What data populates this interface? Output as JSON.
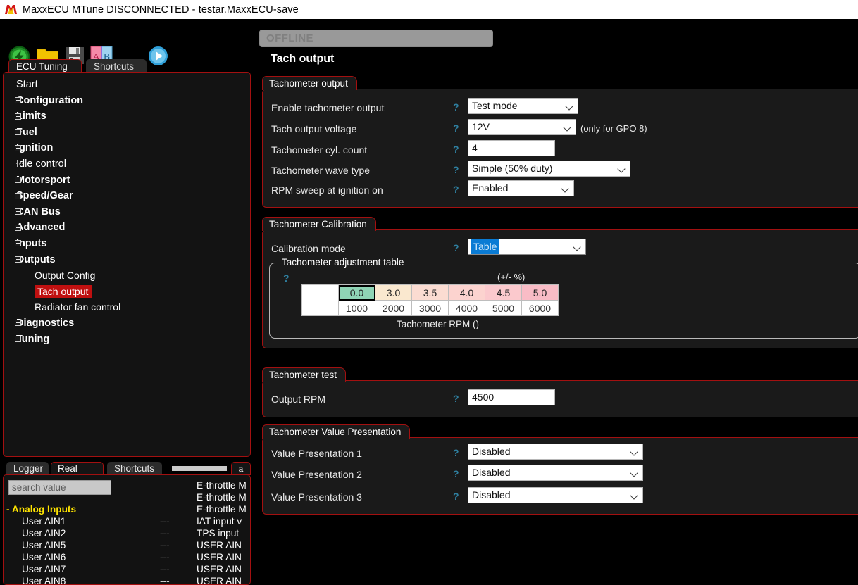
{
  "window": {
    "title": "MaxxECU MTune DISCONNECTED - testar.MaxxECU-save",
    "logo": "maxxecu-m-logo"
  },
  "toolbar": {
    "items": [
      {
        "name": "connect-icon",
        "label": "Connect"
      },
      {
        "name": "open-folder-icon",
        "label": "Open"
      },
      {
        "name": "save-icon",
        "label": "Save"
      },
      {
        "name": "compare-ab-icon",
        "label": "Compare A/B"
      },
      {
        "name": "play-icon",
        "label": "Start"
      }
    ]
  },
  "left_tabs": [
    {
      "label": "ECU Tuning",
      "active": true
    },
    {
      "label": "Shortcuts",
      "active": false
    }
  ],
  "tree": [
    {
      "label": "Start",
      "type": "leaf",
      "depth": 0
    },
    {
      "label": "Configuration",
      "type": "expandable",
      "depth": 0
    },
    {
      "label": "Limits",
      "type": "expandable",
      "depth": 0
    },
    {
      "label": "Fuel",
      "type": "expandable",
      "depth": 0
    },
    {
      "label": "Ignition",
      "type": "expandable",
      "depth": 0
    },
    {
      "label": "Idle control",
      "type": "leaf",
      "depth": 0
    },
    {
      "label": "Motorsport",
      "type": "expandable",
      "depth": 0
    },
    {
      "label": "Speed/Gear",
      "type": "expandable",
      "depth": 0
    },
    {
      "label": "CAN Bus",
      "type": "expandable",
      "depth": 0
    },
    {
      "label": "Advanced",
      "type": "expandable",
      "depth": 0
    },
    {
      "label": "Inputs",
      "type": "expandable",
      "depth": 0
    },
    {
      "label": "Outputs",
      "type": "expanded",
      "depth": 0
    },
    {
      "label": "Output Config",
      "type": "child",
      "depth": 1
    },
    {
      "label": "Tach output",
      "type": "child",
      "depth": 1,
      "selected": true
    },
    {
      "label": "Radiator fan control",
      "type": "child",
      "depth": 1
    },
    {
      "label": "Diagnostics",
      "type": "expandable",
      "depth": 0
    },
    {
      "label": "Tuning",
      "type": "expandable",
      "depth": 0
    }
  ],
  "status_banner": "OFFLINE",
  "page_title": "Tach output",
  "groups": {
    "tach_output": {
      "title": "Tachometer output",
      "rows": [
        {
          "label": "Enable tachometer output",
          "control": "dropdown",
          "value": "Test mode"
        },
        {
          "label": "Tach output voltage",
          "control": "dropdown",
          "value": "12V",
          "note": "(only for GPO 8)"
        },
        {
          "label": "Tachometer cyl. count",
          "control": "text",
          "value": "4"
        },
        {
          "label": "Tachometer wave type",
          "control": "dropdown",
          "value": "Simple (50% duty)"
        },
        {
          "label": "RPM sweep at ignition on",
          "control": "dropdown",
          "value": "Enabled"
        }
      ]
    },
    "tach_calibration": {
      "title": "Tachometer Calibration",
      "mode_label": "Calibration mode",
      "mode_value": "Table",
      "table_legend": "Tachometer adjustment table",
      "table_unit": "(+/- %)",
      "axis_label": "Tachometer RPM ()"
    },
    "tach_test": {
      "title": "Tachometer test",
      "rows": [
        {
          "label": "Output RPM",
          "control": "text",
          "value": "4500"
        }
      ]
    },
    "value_presentation": {
      "title": "Tachometer Value Presentation",
      "rows": [
        {
          "label": "Value Presentation 1",
          "control": "dropdown",
          "value": "Disabled"
        },
        {
          "label": "Value Presentation 2",
          "control": "dropdown",
          "value": "Disabled"
        },
        {
          "label": "Value Presentation 3",
          "control": "dropdown",
          "value": "Disabled"
        }
      ]
    }
  },
  "chart_data": {
    "type": "table",
    "title": "Tachometer adjustment table",
    "xlabel": "Tachometer RPM ()",
    "ylabel": "(+/- %)",
    "categories": [
      "1000",
      "2000",
      "3000",
      "4000",
      "5000",
      "6000"
    ],
    "values": [
      0.0,
      3.0,
      3.5,
      4.0,
      4.5,
      5.0
    ],
    "value_labels": [
      "0.0",
      "3.0",
      "3.5",
      "4.0",
      "4.5",
      "5.0"
    ],
    "selected_index": 0,
    "cell_colors": [
      "#8fd4b5",
      "#fae8cf",
      "#fbdcd2",
      "#fcd3cf",
      "#fbc9cd",
      "#f9bcc6"
    ]
  },
  "bottom_tabs": [
    {
      "label": "Logger",
      "active": false
    },
    {
      "label": "Real Time",
      "active": true
    },
    {
      "label": "Shortcuts",
      "active": false
    }
  ],
  "bottom_stub_tab": "a",
  "realtime": {
    "search_placeholder": "search value",
    "group_label": "Analog Inputs",
    "group_collapse": "-",
    "rows": [
      {
        "name": "User AIN1",
        "value": "---",
        "right": "IAT input v"
      },
      {
        "name": "User AIN2",
        "value": "---",
        "right": "TPS input "
      },
      {
        "name": "User AIN5",
        "value": "---",
        "right": "USER AIN"
      },
      {
        "name": "User AIN6",
        "value": "---",
        "right": "USER AIN"
      },
      {
        "name": "User AIN7",
        "value": "---",
        "right": "USER AIN"
      },
      {
        "name": "User AIN8",
        "value": "---",
        "right": "USER AIN"
      }
    ],
    "right_top": [
      "E-throttle M",
      "E-throttle M",
      "E-throttle M"
    ]
  },
  "colors": {
    "accent_red": "#a31010",
    "selection_red": "#c01010",
    "panel_bg": "#1a1a1a",
    "group_label_yellow": "#ffe400",
    "help_blue": "#2f7f9f",
    "dropdown_select_blue": "#0a7bd4"
  }
}
